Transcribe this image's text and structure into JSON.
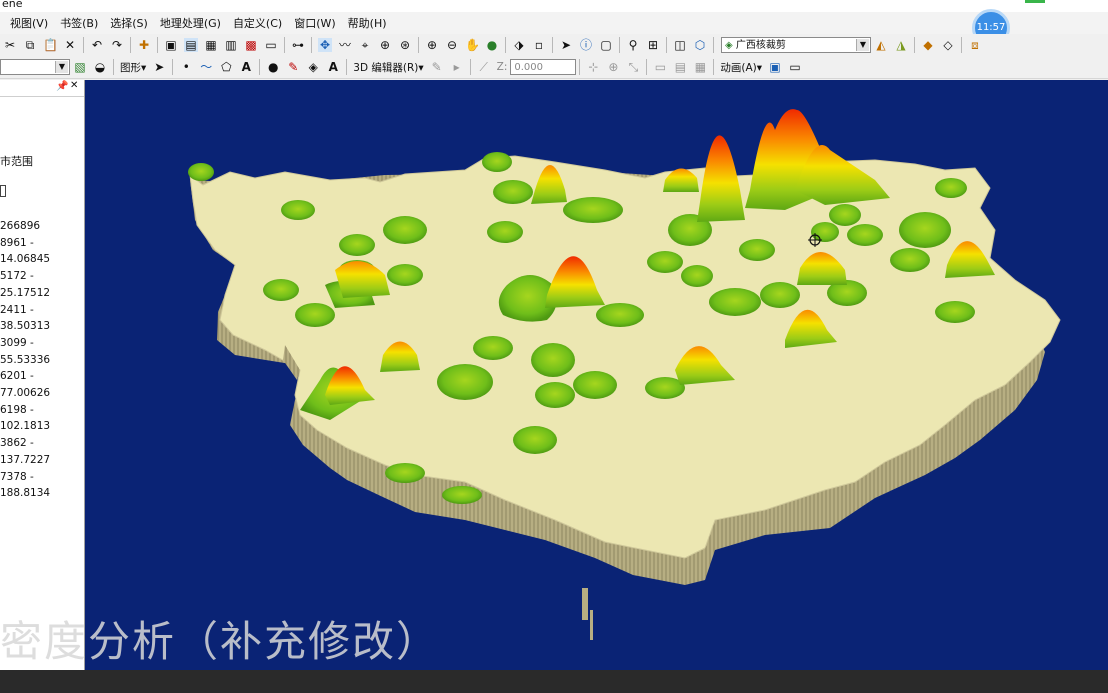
{
  "app": {
    "title_fragment": "ene",
    "clock": "11:57"
  },
  "menu": [
    "视图(V)",
    "书签(B)",
    "选择(S)",
    "地理处理(G)",
    "自定义(C)",
    "窗口(W)",
    "帮助(H)"
  ],
  "toolbar": {
    "layer_select": "广西核裁剪",
    "graphics_label": "图形▾",
    "editor_label": "3D 编辑器(R)▾",
    "z_label": "Z:",
    "z_value": "0.000",
    "animation_label": "动画(A)▾"
  },
  "toc": {
    "layer_name": "市范围",
    "legend": [
      "266896",
      "8961 - 14.06845",
      "5172 - 25.17512",
      "2411 - 38.50313",
      "3099 - 55.53336",
      "6201 - 77.00626",
      "6198 - 102.1813",
      "3862 - 137.7227",
      "7378 - 188.8134"
    ]
  },
  "caption": "密度分析（补充修改）",
  "colors": {
    "scene_bg": "#0a2375",
    "land": "#ece7b2",
    "wall": "#b7ae82",
    "peak_low": "#6fbe1a",
    "peak_mid": "#f5e100",
    "peak_high": "#f02a00"
  }
}
